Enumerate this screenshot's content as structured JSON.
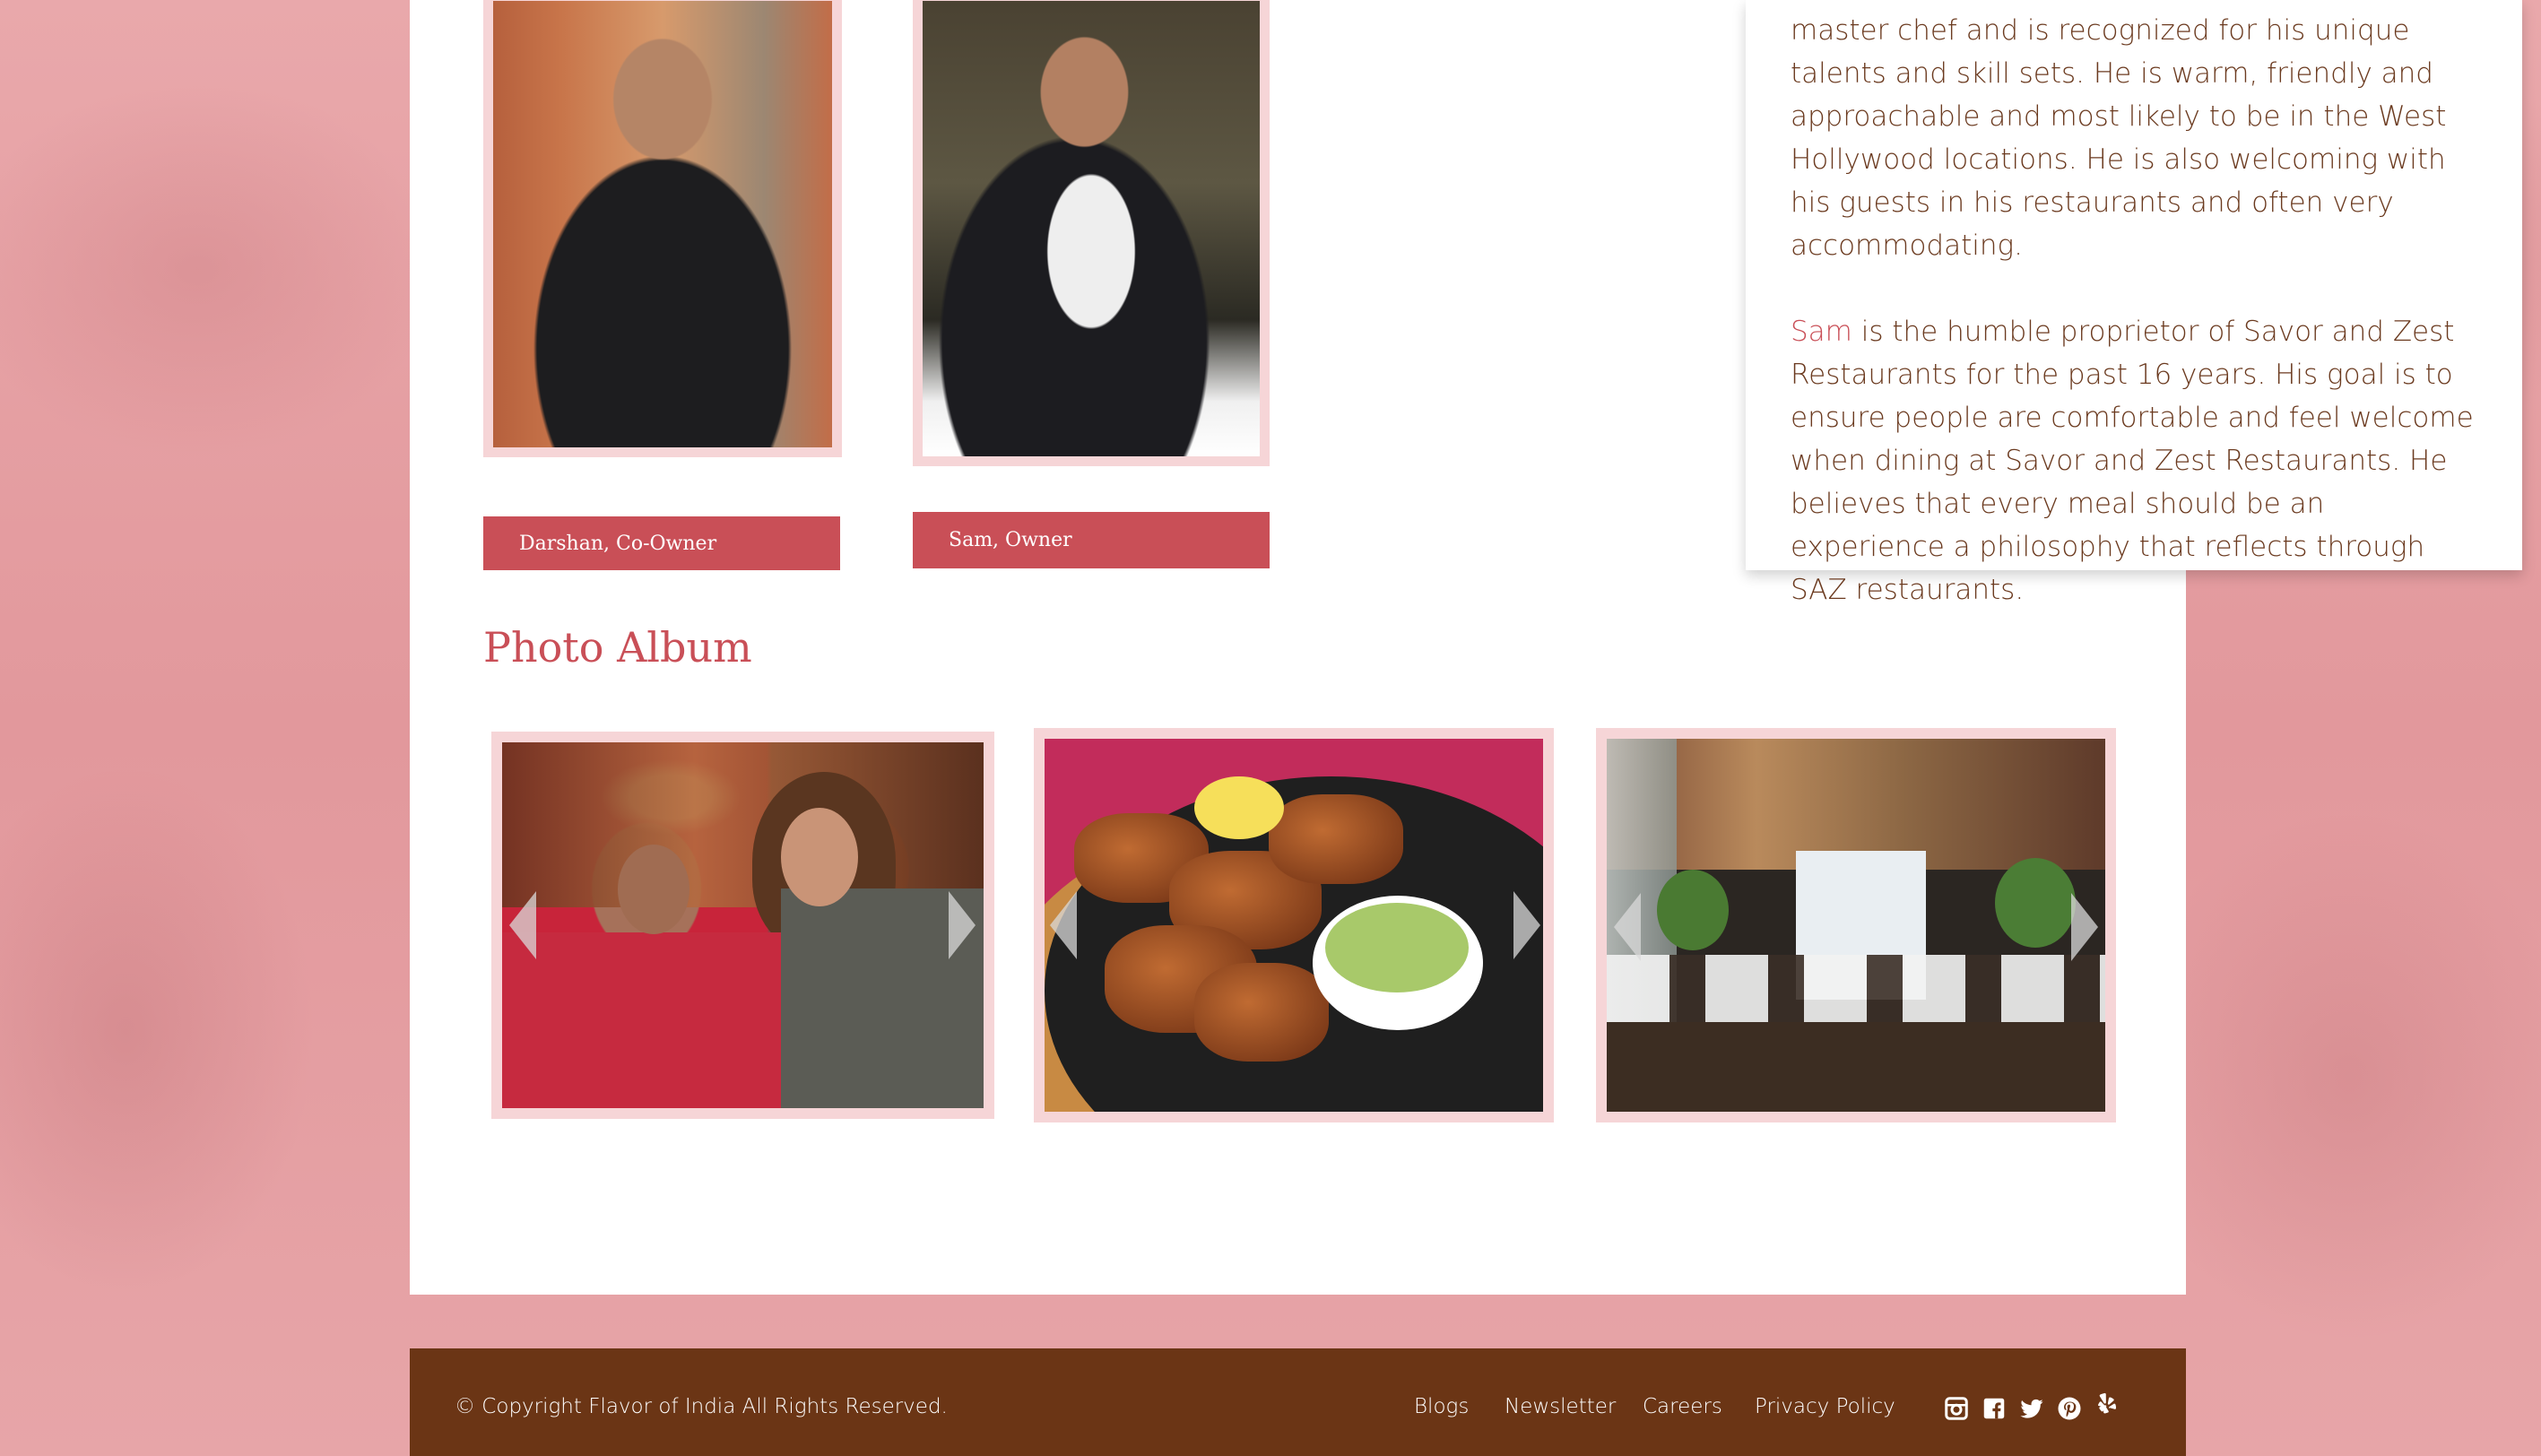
{
  "team": {
    "darshan_label": "Darshan, Co-Owner",
    "sam_label": "Sam, Owner"
  },
  "bio": {
    "paragraph1": "master chef and is recognized for his unique talents and skill sets. He is warm, friendly and approachable and most likely to be in the West Hollywood locations. He is also welcoming with his guests in his restaurants and often very accommodating.",
    "sam_link": "Sam",
    "paragraph2_rest": " is the humble proprietor of Savor and Zest Restaurants for the past 16 years. His goal is to ensure people are comfortable and feel welcome when dining at Savor and Zest Restaurants. He believes that every meal should be an experience a philosophy that reflects through SAZ restaurants."
  },
  "album": {
    "title": "Photo Album"
  },
  "footer": {
    "copyright": "© Copyright Flavor of India All Rights Reserved.",
    "links": [
      "Blogs",
      "Newsletter",
      "Careers",
      "Privacy Policy"
    ],
    "social_icons": [
      "instagram-icon",
      "facebook-icon",
      "twitter-icon",
      "pinterest-icon",
      "yelp-icon"
    ]
  },
  "colors": {
    "accent": "#c94f57",
    "footer_bg": "#6b3515",
    "text": "#6b3a1f",
    "frame": "#f6d5d7"
  }
}
